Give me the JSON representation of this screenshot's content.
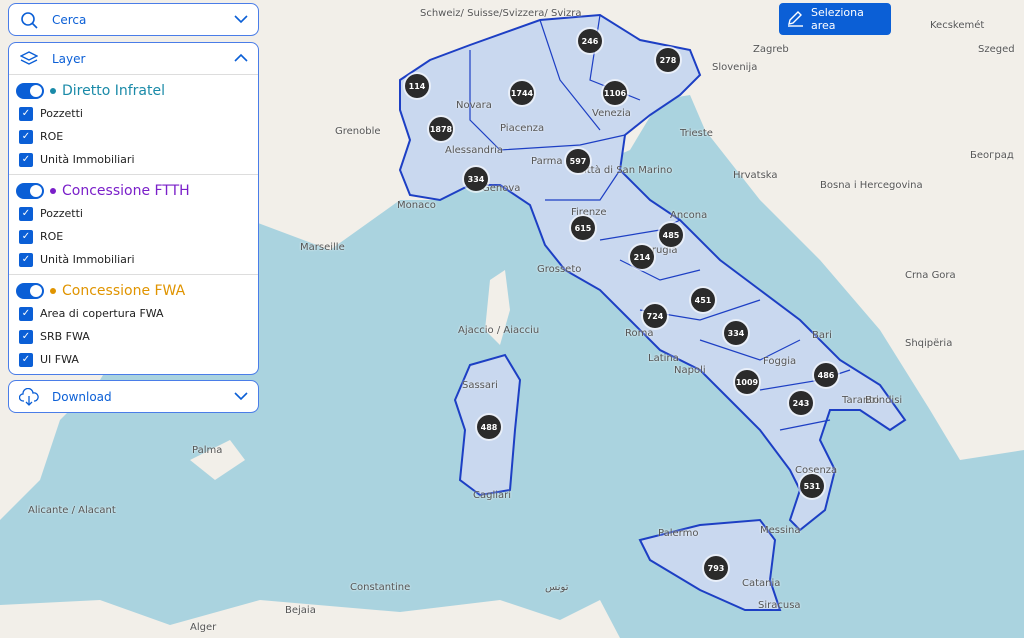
{
  "search": {
    "label": "Cerca",
    "icon": "search-icon"
  },
  "layer": {
    "label": "Layer",
    "icon": "layers-icon",
    "groups": [
      {
        "title": "Diretto Infratel",
        "color": "#1a8aa8",
        "enabled": true,
        "items": [
          {
            "label": "Pozzetti",
            "checked": true
          },
          {
            "label": "ROE",
            "checked": true
          },
          {
            "label": "Unità Immobiliari",
            "checked": true
          }
        ]
      },
      {
        "title": "Concessione FTTH",
        "color": "#7a1fc9",
        "enabled": true,
        "items": [
          {
            "label": "Pozzetti",
            "checked": true
          },
          {
            "label": "ROE",
            "checked": true
          },
          {
            "label": "Unità Immobiliari",
            "checked": true
          }
        ]
      },
      {
        "title": "Concessione FWA",
        "color": "#e09400",
        "enabled": true,
        "items": [
          {
            "label": "Area di copertura FWA",
            "checked": true
          },
          {
            "label": "SRB FWA",
            "checked": true
          },
          {
            "label": "UI FWA",
            "checked": true
          }
        ]
      }
    ]
  },
  "download": {
    "label": "Download",
    "icon": "cloud-download-icon"
  },
  "select_area": {
    "label": "Seleziona area",
    "icon": "edit-icon"
  },
  "clusters": [
    "114",
    "1878",
    "1744",
    "246",
    "278",
    "1106",
    "597",
    "334",
    "615",
    "485",
    "214",
    "451",
    "724",
    "334",
    "486",
    "1009",
    "243",
    "488",
    "531",
    "793"
  ],
  "map_labels": [
    "Schweiz/ Suisse/Svizzera/ Svizra",
    "Zagreb",
    "Slovenija",
    "Trieste",
    "Venezia",
    "Novara",
    "Piacenza",
    "Alessandria",
    "Genova",
    "Parma",
    "Firenze",
    "Grosseto",
    "Perugia",
    "Ancona",
    "Roma",
    "Latina",
    "Napoli",
    "Foggia",
    "Bari",
    "Taranto",
    "Brindisi",
    "Cosenza",
    "Messina",
    "Palermo",
    "Catania",
    "Siracusa",
    "Cagliari",
    "Sassari",
    "Ajaccio / Aiacciu",
    "Monaco",
    "Marseille",
    "Grenoble",
    "Hrvatska",
    "Bosna i Hercegovina",
    "Crna Gora",
    "Shqipëria",
    "Београд",
    "Palma",
    "Alicante / Alacant",
    "Bejaia",
    "Constantine",
    "Alger",
    "تونس",
    "Kecskemét",
    "Szeged",
    "Città di San Marino"
  ]
}
